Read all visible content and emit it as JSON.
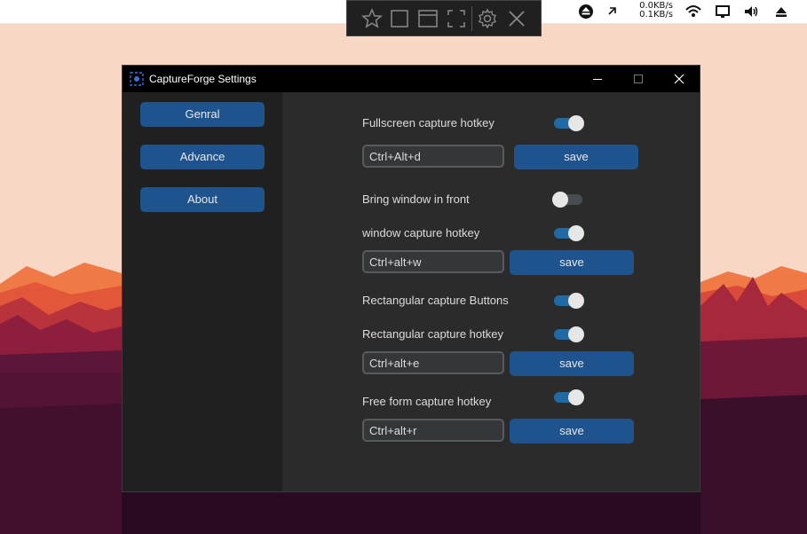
{
  "system_bar": {
    "net_up": "0.0KB/s",
    "net_down": "0.1KB/s",
    "icons": [
      "eject-circle-icon",
      "arrows-icon",
      "wifi-icon",
      "display-icon",
      "volume-icon",
      "eject-icon"
    ]
  },
  "capture_toolbar": {
    "buttons": [
      "star-icon",
      "rectangle-capture-icon",
      "window-capture-icon",
      "fullscreen-capture-icon",
      "settings-icon",
      "close-icon"
    ]
  },
  "window": {
    "title": "CaptureForge Settings",
    "controls": [
      "minimize",
      "maximize",
      "close"
    ]
  },
  "sidebar": {
    "items": [
      {
        "label": "Genral"
      },
      {
        "label": "Advance"
      },
      {
        "label": "About"
      }
    ]
  },
  "settings": {
    "fullscreen_label": "Fullscreen capture hotkey",
    "fullscreen_enabled": true,
    "fullscreen_value": "Ctrl+Alt+d",
    "bring_front_label": "Bring window in front",
    "bring_front_enabled": false,
    "window_label": "window capture hotkey",
    "window_enabled": true,
    "window_value": "Ctrl+alt+w",
    "rect_buttons_label": "Rectangular capture Buttons",
    "rect_buttons_enabled": true,
    "rect_label": "Rectangular capture hotkey",
    "rect_enabled": true,
    "rect_value": "Ctrl+alt+e",
    "freeform_label": "Free form capture hotkey",
    "freeform_enabled": true,
    "freeform_value": "Ctrl+alt+r",
    "save_label": "save"
  },
  "colors": {
    "accent": "#1f538d",
    "toggle_on": "#1f6aa5",
    "window_bg": "#2b2b2b",
    "sidebar_bg": "#202020"
  }
}
